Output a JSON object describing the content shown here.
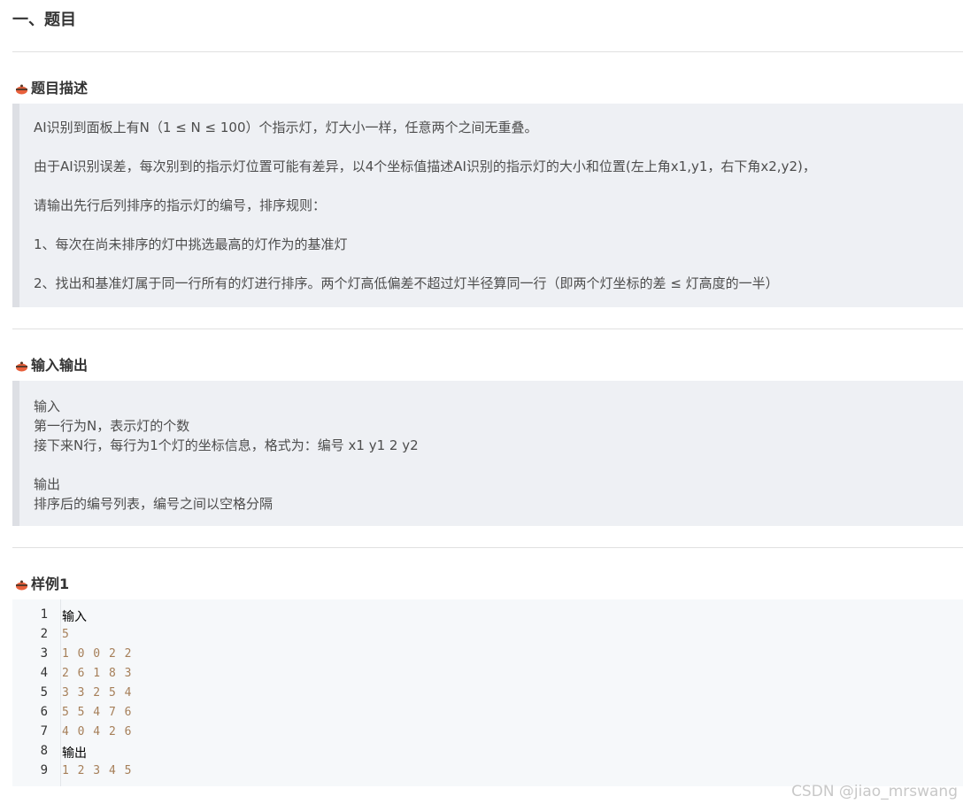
{
  "main_title": "一、题目",
  "sections": {
    "desc": {
      "title": "题目描述",
      "lines": [
        "AI识别到面板上有N（1 ≤ N ≤ 100）个指示灯，灯大小一样，任意两个之间无重叠。",
        "由于AI识别误差，每次别到的指示灯位置可能有差异，以4个坐标值描述AI识别的指示灯的大小和位置(左上角x1,y1，右下角x2,y2)，",
        "请输出先行后列排序的指示灯的编号，排序规则：",
        "1、每次在尚未排序的灯中挑选最高的灯作为的基准灯",
        "2、找出和基准灯属于同一行所有的灯进行排序。两个灯高低偏差不超过灯半径算同一行（即两个灯坐标的差 ≤ 灯高度的一半）"
      ]
    },
    "io": {
      "title": "输入输出",
      "lines": [
        "输入",
        "第一行为N，表示灯的个数",
        "接下来N行，每行为1个灯的坐标信息，格式为：编号 x1 y1 2 y2",
        "",
        "输出",
        "排序后的编号列表，编号之间以空格分隔"
      ]
    },
    "sample": {
      "title": "样例1",
      "code_lines": [
        {
          "n": "1",
          "text": "输入"
        },
        {
          "n": "2",
          "text": "5"
        },
        {
          "n": "3",
          "text": "1 0 0 2 2"
        },
        {
          "n": "4",
          "text": "2 6 1 8 3"
        },
        {
          "n": "5",
          "text": "3 3 2 5 4"
        },
        {
          "n": "6",
          "text": "5 5 4 7 6"
        },
        {
          "n": "7",
          "text": "4 0 4 2 6"
        },
        {
          "n": "8",
          "text": "输出"
        },
        {
          "n": "9",
          "text": "1 2 3 4 5"
        }
      ]
    }
  },
  "watermark": "CSDN @jiao_mrswang",
  "colors": {
    "accent": "#e8603c",
    "quote_bg": "#eef0f4",
    "code_bg": "#f6f8fa",
    "number": "#a67f59"
  }
}
